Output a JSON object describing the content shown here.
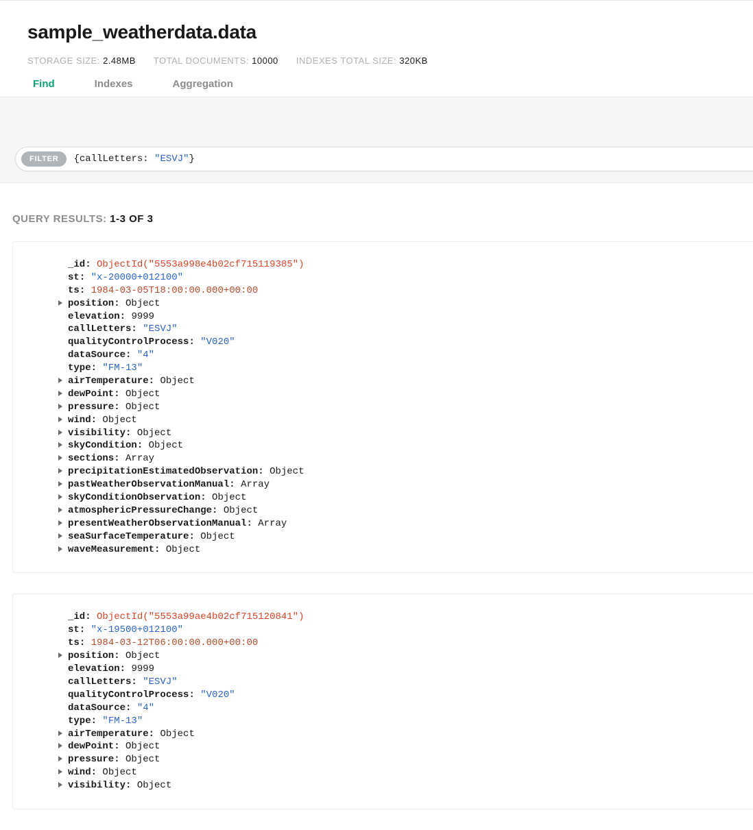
{
  "header": {
    "title": "sample_weatherdata.data",
    "storage_label": "STORAGE SIZE:",
    "storage_value": "2.48MB",
    "total_docs_label": "TOTAL DOCUMENTS:",
    "total_docs_value": "10000",
    "indexes_label": "INDEXES TOTAL SIZE:",
    "indexes_value": "320KB"
  },
  "tabs": {
    "find": "Find",
    "indexes": "Indexes",
    "aggregation": "Aggregation"
  },
  "filter": {
    "pill": "FILTER",
    "open": "{",
    "key": "callLetters: ",
    "value": "\"ESVJ\"",
    "close": "}"
  },
  "results": {
    "label": "QUERY RESULTS: ",
    "count": "1-3 OF 3"
  },
  "documents": [
    {
      "fields": [
        {
          "key": "_id",
          "value": "ObjectId(\"5553a998e4b02cf715119385\")",
          "type": "oid",
          "expandable": false
        },
        {
          "key": "st",
          "value": "\"x-20000+012100\"",
          "type": "str",
          "expandable": false
        },
        {
          "key": "ts",
          "value": "1984-03-05T18:00:00.000+00:00",
          "type": "date",
          "expandable": false
        },
        {
          "key": "position",
          "value": "Object",
          "type": "obj",
          "expandable": true
        },
        {
          "key": "elevation",
          "value": "9999",
          "type": "num",
          "expandable": false
        },
        {
          "key": "callLetters",
          "value": "\"ESVJ\"",
          "type": "str",
          "expandable": false
        },
        {
          "key": "qualityControlProcess",
          "value": "\"V020\"",
          "type": "str",
          "expandable": false
        },
        {
          "key": "dataSource",
          "value": "\"4\"",
          "type": "str",
          "expandable": false
        },
        {
          "key": "type",
          "value": "\"FM-13\"",
          "type": "str",
          "expandable": false
        },
        {
          "key": "airTemperature",
          "value": "Object",
          "type": "obj",
          "expandable": true
        },
        {
          "key": "dewPoint",
          "value": "Object",
          "type": "obj",
          "expandable": true
        },
        {
          "key": "pressure",
          "value": "Object",
          "type": "obj",
          "expandable": true
        },
        {
          "key": "wind",
          "value": "Object",
          "type": "obj",
          "expandable": true
        },
        {
          "key": "visibility",
          "value": "Object",
          "type": "obj",
          "expandable": true
        },
        {
          "key": "skyCondition",
          "value": "Object",
          "type": "obj",
          "expandable": true
        },
        {
          "key": "sections",
          "value": "Array",
          "type": "obj",
          "expandable": true
        },
        {
          "key": "precipitationEstimatedObservation",
          "value": "Object",
          "type": "obj",
          "expandable": true
        },
        {
          "key": "pastWeatherObservationManual",
          "value": "Array",
          "type": "obj",
          "expandable": true
        },
        {
          "key": "skyConditionObservation",
          "value": "Object",
          "type": "obj",
          "expandable": true
        },
        {
          "key": "atmosphericPressureChange",
          "value": "Object",
          "type": "obj",
          "expandable": true
        },
        {
          "key": "presentWeatherObservationManual",
          "value": "Array",
          "type": "obj",
          "expandable": true
        },
        {
          "key": "seaSurfaceTemperature",
          "value": "Object",
          "type": "obj",
          "expandable": true
        },
        {
          "key": "waveMeasurement",
          "value": "Object",
          "type": "obj",
          "expandable": true
        }
      ]
    },
    {
      "fields": [
        {
          "key": "_id",
          "value": "ObjectId(\"5553a99ae4b02cf715120841\")",
          "type": "oid",
          "expandable": false
        },
        {
          "key": "st",
          "value": "\"x-19500+012100\"",
          "type": "str",
          "expandable": false
        },
        {
          "key": "ts",
          "value": "1984-03-12T06:00:00.000+00:00",
          "type": "date",
          "expandable": false
        },
        {
          "key": "position",
          "value": "Object",
          "type": "obj",
          "expandable": true
        },
        {
          "key": "elevation",
          "value": "9999",
          "type": "num",
          "expandable": false
        },
        {
          "key": "callLetters",
          "value": "\"ESVJ\"",
          "type": "str",
          "expandable": false
        },
        {
          "key": "qualityControlProcess",
          "value": "\"V020\"",
          "type": "str",
          "expandable": false
        },
        {
          "key": "dataSource",
          "value": "\"4\"",
          "type": "str",
          "expandable": false
        },
        {
          "key": "type",
          "value": "\"FM-13\"",
          "type": "str",
          "expandable": false
        },
        {
          "key": "airTemperature",
          "value": "Object",
          "type": "obj",
          "expandable": true
        },
        {
          "key": "dewPoint",
          "value": "Object",
          "type": "obj",
          "expandable": true
        },
        {
          "key": "pressure",
          "value": "Object",
          "type": "obj",
          "expandable": true
        },
        {
          "key": "wind",
          "value": "Object",
          "type": "obj",
          "expandable": true
        },
        {
          "key": "visibility",
          "value": "Object",
          "type": "obj",
          "expandable": true
        }
      ]
    }
  ]
}
